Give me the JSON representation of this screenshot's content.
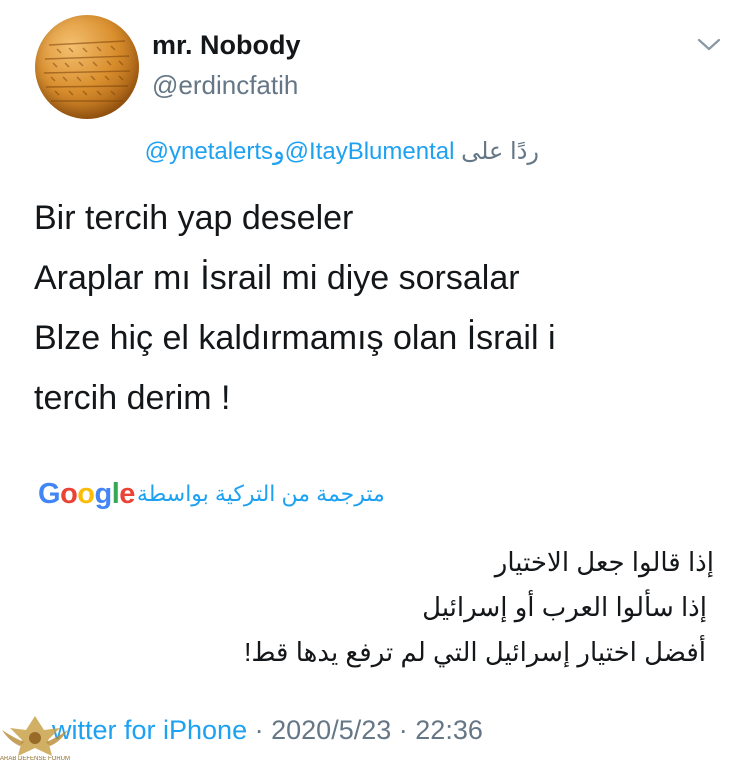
{
  "tweet": {
    "author": {
      "display_name": "mr. Nobody",
      "handle": "@erdincfatih"
    },
    "reply_to": {
      "prefix": "ردًا على",
      "mention_1": "@ItayBlumental",
      "conjunction": "و",
      "mention_2": "@ynetalerts"
    },
    "text_lines": [
      "Bir tercih yap deseler",
      "Araplar mı İsrail mi diye sorsalar",
      "Blze hiç el kaldırmamış olan İsrail i",
      "tercih derim !"
    ],
    "translation": {
      "label": "مترجمة من التركية بواسطة",
      "provider": "Google",
      "lines": [
        "إذا قالوا جعل الاختيار",
        "إذا سألوا العرب أو إسرائيل",
        "أفضل اختيار إسرائيل التي لم ترفع يدها قط!"
      ]
    },
    "footer": {
      "source": "witter for iPhone",
      "separator": "·",
      "date": "2020/5/23",
      "time": "22:36"
    },
    "icons": {
      "menu": "chevron-down-icon",
      "avatar": "clay-tablet-avatar"
    },
    "colors": {
      "link": "#1da1f2",
      "secondary_text": "#657786",
      "primary_text": "#14171a"
    }
  },
  "watermark": {
    "text": "ARAB DEFENSE FORUM"
  }
}
